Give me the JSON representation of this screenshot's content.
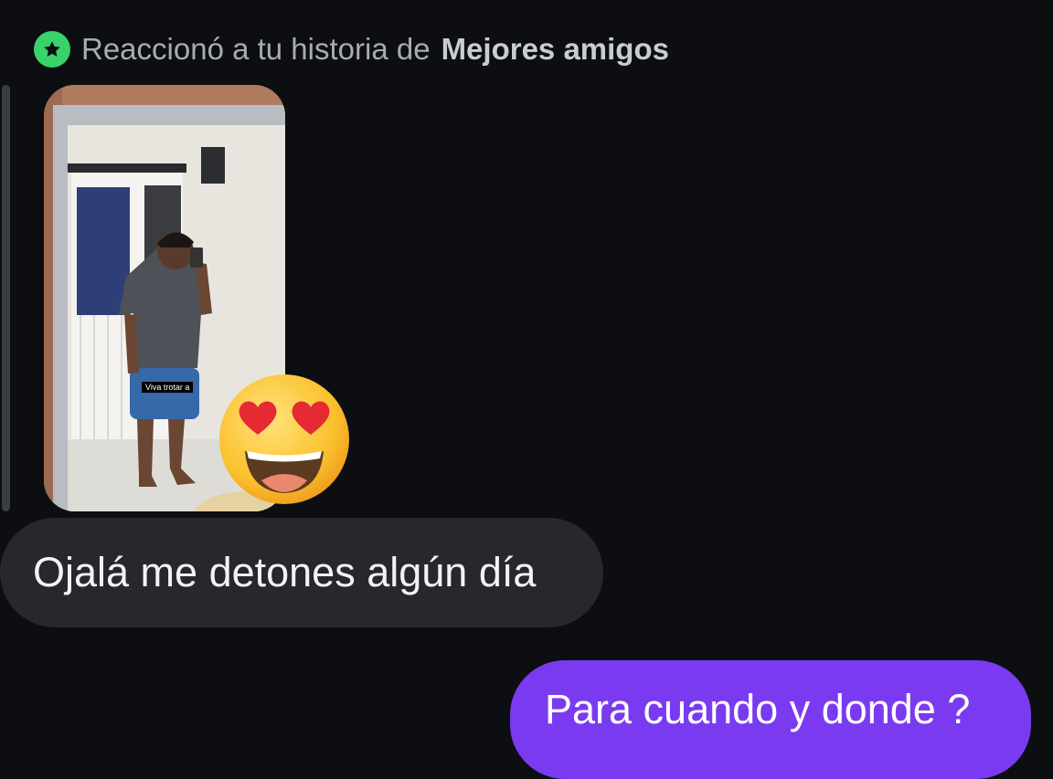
{
  "reply_header": {
    "icon": "star-icon",
    "icon_color": "#39d36b",
    "prefix": "Reaccionó a tu historia de",
    "list_name": "Mejores amigos"
  },
  "story": {
    "caption": "Viva trotar a",
    "reaction": "heart-eyes-emoji"
  },
  "messages": {
    "received": "Ojalá me detones algún día",
    "sent": "Para cuando y donde ?"
  },
  "colors": {
    "background": "#0c0e12",
    "received_bubble": "#26282d",
    "sent_bubble": "#7a3bf0"
  }
}
